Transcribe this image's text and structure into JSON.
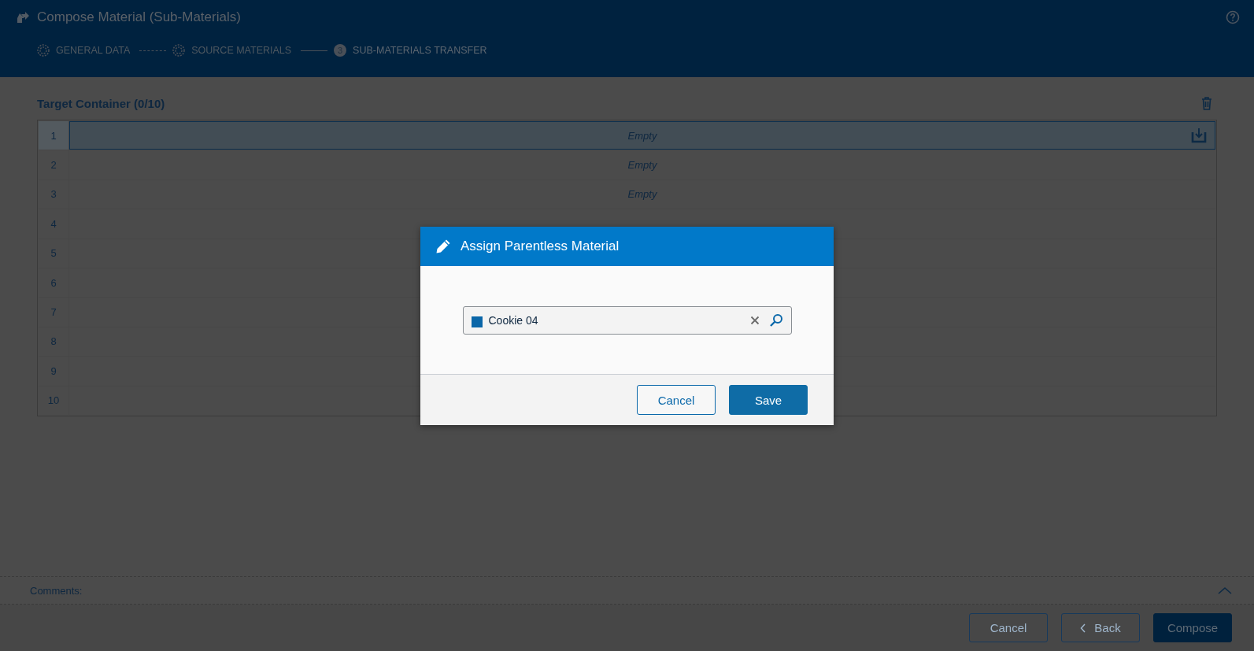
{
  "header": {
    "title": "Compose Material (Sub-Materials)",
    "steps": [
      {
        "label": "GENERAL DATA",
        "kind": "done",
        "selected": false
      },
      {
        "label": "SOURCE MATERIALS",
        "kind": "done",
        "selected": false
      },
      {
        "label": "SUB-MATERIALS TRANSFER",
        "kind": "numbered",
        "number": "3",
        "selected": true
      }
    ]
  },
  "container": {
    "title": "Target Container (0/10)",
    "rows": [
      {
        "index": "1",
        "content": "Empty",
        "selected": true
      },
      {
        "index": "2",
        "content": "Empty",
        "selected": false
      },
      {
        "index": "3",
        "content": "Empty",
        "selected": false
      },
      {
        "index": "4",
        "selected": false
      },
      {
        "index": "5",
        "selected": false
      },
      {
        "index": "6",
        "selected": false
      },
      {
        "index": "7",
        "selected": false
      },
      {
        "index": "8",
        "selected": false
      },
      {
        "index": "9",
        "selected": false
      },
      {
        "index": "10",
        "selected": false
      }
    ]
  },
  "comments": {
    "label": "Comments:"
  },
  "footer": {
    "buttons": [
      {
        "label": "Cancel",
        "kind": "outline"
      },
      {
        "label": "Back",
        "kind": "back"
      },
      {
        "label": "Compose",
        "kind": "primary"
      }
    ]
  },
  "dialog": {
    "title": "Assign Parentless Material",
    "field": {
      "value": "Cookie 04"
    },
    "buttons": [
      {
        "label": "Cancel",
        "kind": "outline"
      },
      {
        "label": "Save",
        "kind": "primary"
      }
    ]
  }
}
